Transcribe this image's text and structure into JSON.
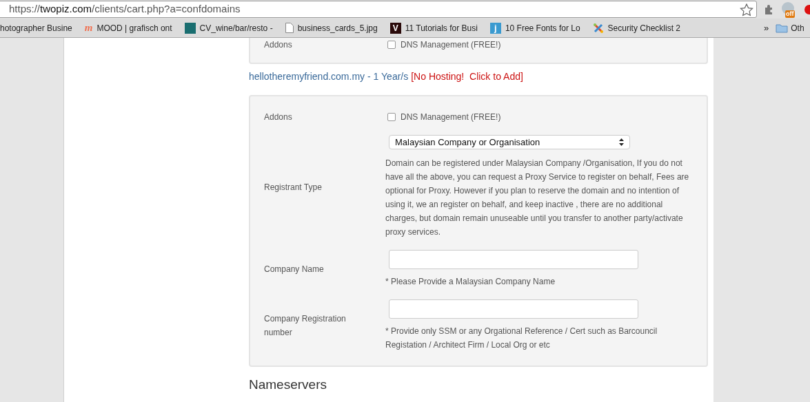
{
  "browser": {
    "url_scheme": "https://",
    "url_host": "twopiz.com",
    "url_path": "/clients/cart.php?a=confdomains",
    "extension_badge": "off",
    "bookmarks": [
      {
        "kind": "none",
        "label": "hotographer Busine"
      },
      {
        "kind": "letter",
        "icon_text": "m",
        "label": "MOOD | grafisch ont"
      },
      {
        "kind": "square",
        "label": "CV_wine/bar/resto -"
      },
      {
        "kind": "document",
        "label": "business_cards_5.jpg"
      },
      {
        "kind": "badge-dark",
        "icon_text": "V",
        "label": "11 Tutorials for Busi"
      },
      {
        "kind": "badge-blue",
        "icon_text": "j",
        "label": "10 Free Fonts for Lo"
      },
      {
        "kind": "cross",
        "label": "Security Checklist 2"
      }
    ],
    "overflow": "»",
    "folder": "Oth"
  },
  "top_card": {
    "rows": [
      {
        "kind": "checkbox",
        "label": "Addons",
        "option": "DNS Management (FREE!)",
        "checked": false
      }
    ]
  },
  "domain_line": {
    "name": "hellotheremyfriend.com.my",
    "term": "- 1 Year/s",
    "hosting_link": "[No Hosting!  Click to Add]"
  },
  "card": {
    "rows": [
      {
        "kind": "checkbox",
        "label": "Addons",
        "option": "DNS Management (FREE!)",
        "checked": false
      },
      {
        "kind": "select",
        "label": "Registrant Type",
        "value": "Malaysian Company or Organisation",
        "note": "Domain can be registered under Malaysian Company /Organisation, If you do not have all the above, you can request a Proxy Service to register on behalf, Fees are optional for Proxy. However if you plan to reserve the domain and no intention of using it, we an register on behalf, and keep inactive , there are no additional charges, but domain remain unuseable until you transfer to another party/activate proxy services."
      },
      {
        "kind": "text",
        "label": "Company Name",
        "note": "* Please Provide a Malaysian Company Name"
      },
      {
        "kind": "text",
        "label": "Company Registration number",
        "note": "* Provide only SSM or any Orgational Reference / Cert such as Barcouncil Registation / Architect Firm / Local Org or etc"
      }
    ]
  },
  "heading": "Nameservers"
}
